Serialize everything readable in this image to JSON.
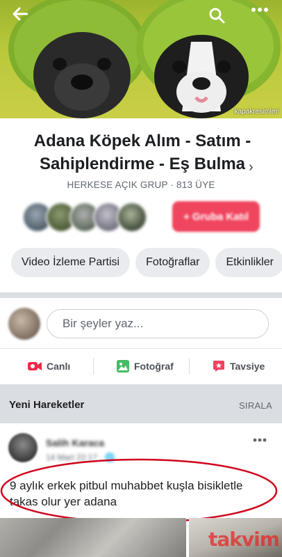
{
  "cover": {
    "caption": "kapakresimleri",
    "icons": [
      "back-arrow-icon",
      "search-icon",
      "more-dots-icon"
    ]
  },
  "group": {
    "name": "Adana Köpek Alım - Satım - Sahiplendirme - Eş Bulma",
    "meta": "HERKESE AÇIK GRUP · 813 ÜYE",
    "join_label": "+ Gruba Katıl"
  },
  "chips": [
    "Video İzleme Partisi",
    "Fotoğraflar",
    "Etkinlikler"
  ],
  "composer": {
    "placeholder": "Bir şeyler yaz..."
  },
  "actions": [
    {
      "label": "Canlı",
      "icon": "live-video-icon",
      "color": "#f02849"
    },
    {
      "label": "Fotoğraf",
      "icon": "photo-icon",
      "color": "#45bd62"
    },
    {
      "label": "Tavsiye",
      "icon": "recommend-icon",
      "color": "#f3425f"
    }
  ],
  "activity": {
    "title": "Yeni Hareketler",
    "sort_label": "SIRALA"
  },
  "post": {
    "author": "Salih Karaca",
    "time": "14 Mart 22:17 · 🌐",
    "text": "9 aylık erkek pitbul muhabbet kuşla bisikletle takas olur yer adana"
  },
  "watermark": "takvim",
  "colors": {
    "accent": "#f0455e",
    "highlight": "#d0021b"
  }
}
